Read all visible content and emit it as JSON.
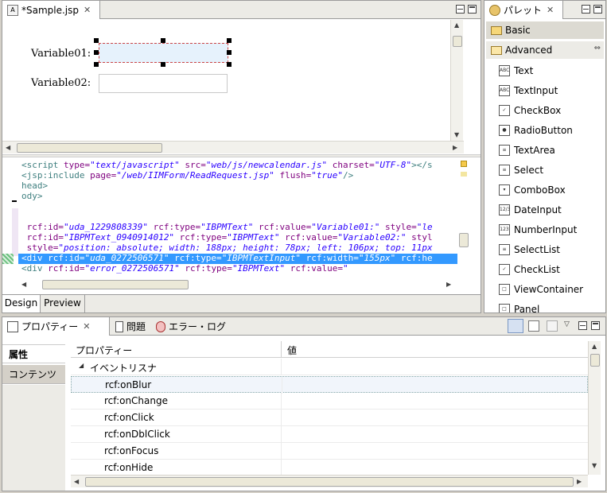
{
  "editor": {
    "tab_title": "*Sample.jsp",
    "close_glyph": "✕",
    "design_tab": "Design",
    "preview_tab": "Preview",
    "form": {
      "label1": "Variable01:",
      "label2": "Variable02:"
    },
    "source_lines": [
      {
        "parts": [
          [
            "t",
            "<script "
          ],
          [
            "a",
            "type="
          ],
          [
            "v",
            "\"text/javascript\""
          ],
          [
            "a",
            " src="
          ],
          [
            "v",
            "\"web/js/newcalendar.js\""
          ],
          [
            "a",
            " charset="
          ],
          [
            "v",
            "\"UTF-8\""
          ],
          [
            "t",
            "></s"
          ]
        ]
      },
      {
        "parts": [
          [
            "t",
            "<jsp:include "
          ],
          [
            "a",
            "page="
          ],
          [
            "v",
            "\"/web/IIMForm/ReadRequest.jsp\""
          ],
          [
            "a",
            " flush="
          ],
          [
            "v",
            "\"true\""
          ],
          [
            "t",
            "/>"
          ]
        ]
      },
      {
        "parts": [
          [
            "t",
            "head>"
          ]
        ]
      },
      {
        "parts": [
          [
            "t",
            "ody>"
          ]
        ]
      },
      {
        "parts": [
          [
            "t",
            ""
          ]
        ]
      },
      {
        "parts": [
          [
            "t",
            ""
          ]
        ]
      },
      {
        "parts": [
          [
            "a",
            " rcf:id="
          ],
          [
            "v",
            "\"uda_1229808339\""
          ],
          [
            "a",
            " rcf:type="
          ],
          [
            "v",
            "\"IBPMText\""
          ],
          [
            "a",
            " rcf:value="
          ],
          [
            "v",
            "\"Variable01:\""
          ],
          [
            "a",
            " style="
          ],
          [
            "v",
            "\"le"
          ]
        ]
      },
      {
        "parts": [
          [
            "a",
            " rcf:id="
          ],
          [
            "v",
            "\"IBPMText_0940914012\""
          ],
          [
            "a",
            " rcf:type="
          ],
          [
            "v",
            "\"IBPMText\""
          ],
          [
            "a",
            " rcf:value="
          ],
          [
            "v",
            "\"Variable02:\""
          ],
          [
            "a",
            " styl"
          ]
        ]
      },
      {
        "parts": [
          [
            "a",
            " style="
          ],
          [
            "v",
            "\"position: absolute; width: 188px; height: 78px; left: 106px; top: 11px"
          ]
        ]
      },
      {
        "parts": [
          [
            "t",
            "<div "
          ],
          [
            "a",
            "rcf:id="
          ],
          [
            "v",
            "\"uda_0272506571\""
          ],
          [
            "a",
            " rcf:type="
          ],
          [
            "v",
            "\"IBPMTextInput\""
          ],
          [
            "a",
            " rcf:width="
          ],
          [
            "v",
            "\"155px\""
          ],
          [
            "a",
            " rcf:he"
          ]
        ]
      },
      {
        "parts": [
          [
            "t",
            "<div "
          ],
          [
            "a",
            "rcf:id="
          ],
          [
            "v",
            "\"error_0272506571\""
          ],
          [
            "a",
            " rcf:type="
          ],
          [
            "v",
            "\"IBPMText\""
          ],
          [
            "a",
            " rcf:value="
          ],
          [
            "v",
            "\""
          ]
        ]
      }
    ]
  },
  "palette": {
    "tab_title": "パレット",
    "close_glyph": "✕",
    "basic": "Basic",
    "advanced": "Advanced",
    "items": [
      {
        "label": "Text",
        "icon": "text-icon",
        "glyph": "ABC"
      },
      {
        "label": "TextInput",
        "icon": "textinput-icon",
        "glyph": "ABC"
      },
      {
        "label": "CheckBox",
        "icon": "checkbox-icon",
        "glyph": "✓"
      },
      {
        "label": "RadioButton",
        "icon": "radiobutton-icon",
        "glyph": "●"
      },
      {
        "label": "TextArea",
        "icon": "textarea-icon",
        "glyph": "≡"
      },
      {
        "label": "Select",
        "icon": "select-icon",
        "glyph": "≡"
      },
      {
        "label": "ComboBox",
        "icon": "combobox-icon",
        "glyph": "▾"
      },
      {
        "label": "DateInput",
        "icon": "dateinput-icon",
        "glyph": "12/3"
      },
      {
        "label": "NumberInput",
        "icon": "numberinput-icon",
        "glyph": "123"
      },
      {
        "label": "SelectList",
        "icon": "selectlist-icon",
        "glyph": "≡"
      },
      {
        "label": "CheckList",
        "icon": "checklist-icon",
        "glyph": "✓"
      },
      {
        "label": "ViewContainer",
        "icon": "viewcontainer-icon",
        "glyph": "□"
      },
      {
        "label": "Panel",
        "icon": "panel-icon",
        "glyph": "□"
      }
    ]
  },
  "bottom": {
    "tabs": [
      {
        "label": "プロパティー",
        "icon": "properties-icon"
      },
      {
        "label": "問題",
        "icon": "problems-icon"
      },
      {
        "label": "エラー・ログ",
        "icon": "error-log-icon"
      }
    ],
    "close_glyph": "✕",
    "side_tabs": [
      "属性",
      "コンテンツ"
    ],
    "headers": [
      "プロパティー",
      "値"
    ],
    "group": "イベントリスナ",
    "rows": [
      "rcf:onBlur",
      "rcf:onChange",
      "rcf:onClick",
      "rcf:onDblClick",
      "rcf:onFocus",
      "rcf:onHide"
    ]
  },
  "colors": {
    "selection": "#3399ff",
    "tab_bg": "#ecebe6"
  }
}
